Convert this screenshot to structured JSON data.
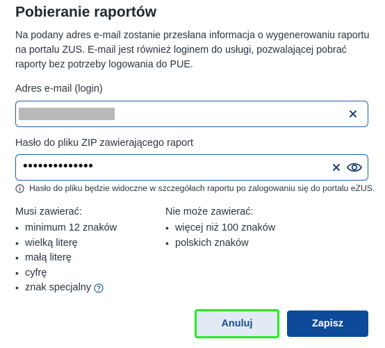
{
  "dialog": {
    "title": "Pobieranie raportów",
    "description": "Na podany adres e-mail zostanie przesłana informacja o wygenerowaniu raportu na portalu ZUS. E-mail jest również loginem do usługi, pozwalającej pobrać raporty bez potrzeby logowania do PUE."
  },
  "email": {
    "label": "Adres e-mail (login)",
    "value_redacted": true
  },
  "password": {
    "label": "Hasło do pliku ZIP zawierającego raport",
    "value": "••••••••••••••",
    "hint": "Hasło do pliku będzie widoczne w szczegółach raportu po zalogowaniu się do portalu eZUS."
  },
  "rules": {
    "must_title": "Musi zawierać:",
    "must": [
      "minimum 12 znaków",
      "wielką literę",
      "małą literę",
      "cyfrę",
      "znak specjalny"
    ],
    "mustnot_title": "Nie może zawierać:",
    "mustnot": [
      "więcej niż 100 znaków",
      "polskich znaków"
    ]
  },
  "buttons": {
    "cancel": "Anuluj",
    "save": "Zapisz"
  },
  "colors": {
    "primary": "#0d4a9a",
    "field_border": "#1f5ea8",
    "focus_outline": "#22ee22"
  },
  "icons": [
    "clear-icon",
    "eye-icon",
    "info-icon",
    "help-icon"
  ]
}
